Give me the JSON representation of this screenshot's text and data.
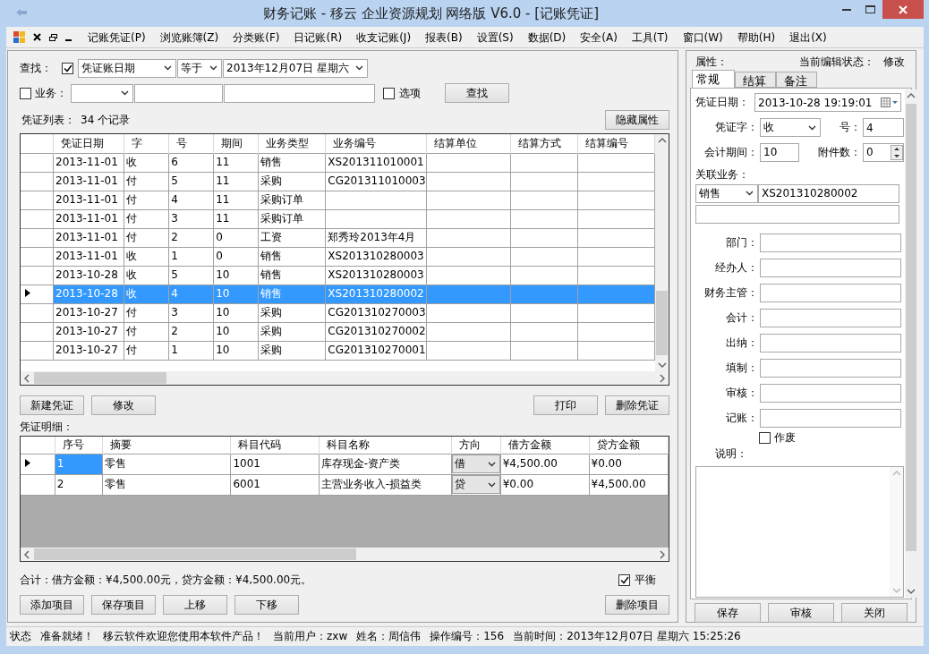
{
  "window": {
    "title": "财务记账 - 移云 企业资源规划 网络版 V6.0 - [记账凭证]"
  },
  "menu": [
    "记账凭证(P)",
    "浏览账簿(Z)",
    "分类账(F)",
    "日记账(R)",
    "收支记账(J)",
    "报表(B)",
    "设置(S)",
    "数据(D)",
    "安全(A)",
    "工具(T)",
    "窗口(W)",
    "帮助(H)",
    "退出(X)"
  ],
  "search": {
    "label": "查找：",
    "field_checked": true,
    "field": "凭证账日期",
    "operator": "等于",
    "value": "2013年12月07日  星期六",
    "business_checked": false,
    "business_label": "业务：",
    "options_checked": false,
    "options_label": "选项",
    "button": "查找"
  },
  "list": {
    "label": "凭证列表：",
    "count": "34 个记录",
    "hide_button": "隐藏属性",
    "columns": [
      "凭证日期",
      "字",
      "号",
      "期间",
      "业务类型",
      "业务编号",
      "结算单位",
      "结算方式",
      "结算编号"
    ],
    "rows": [
      {
        "cells": [
          "2013-11-01",
          "收",
          "6",
          "11",
          "销售",
          "XS201311010001"
        ],
        "selected": false
      },
      {
        "cells": [
          "2013-11-01",
          "付",
          "5",
          "11",
          "采购",
          "CG201311010003"
        ],
        "selected": false
      },
      {
        "cells": [
          "2013-11-01",
          "付",
          "4",
          "11",
          "采购订单"
        ],
        "selected": false
      },
      {
        "cells": [
          "2013-11-01",
          "付",
          "3",
          "11",
          "采购订单"
        ],
        "selected": false
      },
      {
        "cells": [
          "2013-11-01",
          "付",
          "2",
          "0",
          "工资",
          "郑秀玲2013年4月"
        ],
        "selected": false
      },
      {
        "cells": [
          "2013-11-01",
          "收",
          "1",
          "0",
          "销售",
          "XS201310280003"
        ],
        "selected": false
      },
      {
        "cells": [
          "2013-10-28",
          "收",
          "5",
          "10",
          "销售",
          "XS201310280003"
        ],
        "selected": false
      },
      {
        "cells": [
          "2013-10-28",
          "收",
          "4",
          "10",
          "销售",
          "XS201310280002"
        ],
        "selected": true
      },
      {
        "cells": [
          "2013-10-27",
          "付",
          "3",
          "10",
          "采购",
          "CG201310270003"
        ],
        "selected": false
      },
      {
        "cells": [
          "2013-10-27",
          "付",
          "2",
          "10",
          "采购",
          "CG201310270002"
        ],
        "selected": false
      },
      {
        "cells": [
          "2013-10-27",
          "付",
          "1",
          "10",
          "采购",
          "CG201310270001"
        ],
        "selected": false
      }
    ]
  },
  "list_buttons": {
    "left": [
      "新建凭证",
      "修改"
    ],
    "right": [
      "打印",
      "删除凭证"
    ]
  },
  "detail": {
    "label": "凭证明细：",
    "columns": [
      "序号",
      "摘要",
      "科目代码",
      "科目名称",
      "方向",
      "借方金额",
      "贷方金额"
    ],
    "rows": [
      {
        "cells": [
          "1",
          "零售",
          "1001",
          "库存现金-资产类"
        ],
        "direction": "借",
        "debit": "¥4,500.00",
        "credit": "¥0.00",
        "selected": true
      },
      {
        "cells": [
          "2",
          "零售",
          "6001",
          "主营业务收入-损益类"
        ],
        "direction": "贷",
        "debit": "¥0.00",
        "credit": "¥4,500.00",
        "selected": false
      }
    ]
  },
  "totals": "合计：借方金额：¥4,500.00元，贷方金额：¥4,500.00元。",
  "balance": {
    "label": "平衡",
    "checked": true
  },
  "detail_buttons": {
    "left": [
      "添加项目",
      "保存项目",
      "上移",
      "下移"
    ],
    "right": [
      "删除项目"
    ]
  },
  "properties": {
    "title": "属性：",
    "state_label": "当前编辑状态：",
    "state": "修改",
    "tabs": [
      {
        "label": "常规",
        "selected": true
      },
      {
        "label": "结算",
        "selected": false
      },
      {
        "label": "备注",
        "selected": false
      }
    ],
    "date": {
      "label": "凭证日期：",
      "value": "2013-10-28  19:19:01"
    },
    "voucher_word": {
      "label": "凭证字：",
      "value": "收"
    },
    "number": {
      "label": "号：",
      "value": "4"
    },
    "period": {
      "label": "会计期间：",
      "value": "10"
    },
    "attachments": {
      "label": "附件数：",
      "value": "0"
    },
    "related": {
      "label": "关联业务：",
      "type": "销售",
      "value": "XS201310280002"
    },
    "people": [
      {
        "label": "部门："
      },
      {
        "label": "经办人："
      },
      {
        "label": "财务主管："
      },
      {
        "label": "会计："
      },
      {
        "label": "出纳："
      },
      {
        "label": "填制："
      },
      {
        "label": "审核："
      },
      {
        "label": "记账："
      }
    ],
    "void": {
      "label": "作废",
      "checked": false
    },
    "note": {
      "label": "说明："
    },
    "buttons": [
      "保存",
      "审核",
      "关闭"
    ]
  },
  "status_bar": [
    "状态",
    "准备就绪！",
    "移云软件欢迎您使用本软件产品！",
    "当前用户：zxw",
    "姓名：周信伟",
    "操作编号：156",
    "当前时间：2013年12月07日 星期六 15:25:26"
  ]
}
